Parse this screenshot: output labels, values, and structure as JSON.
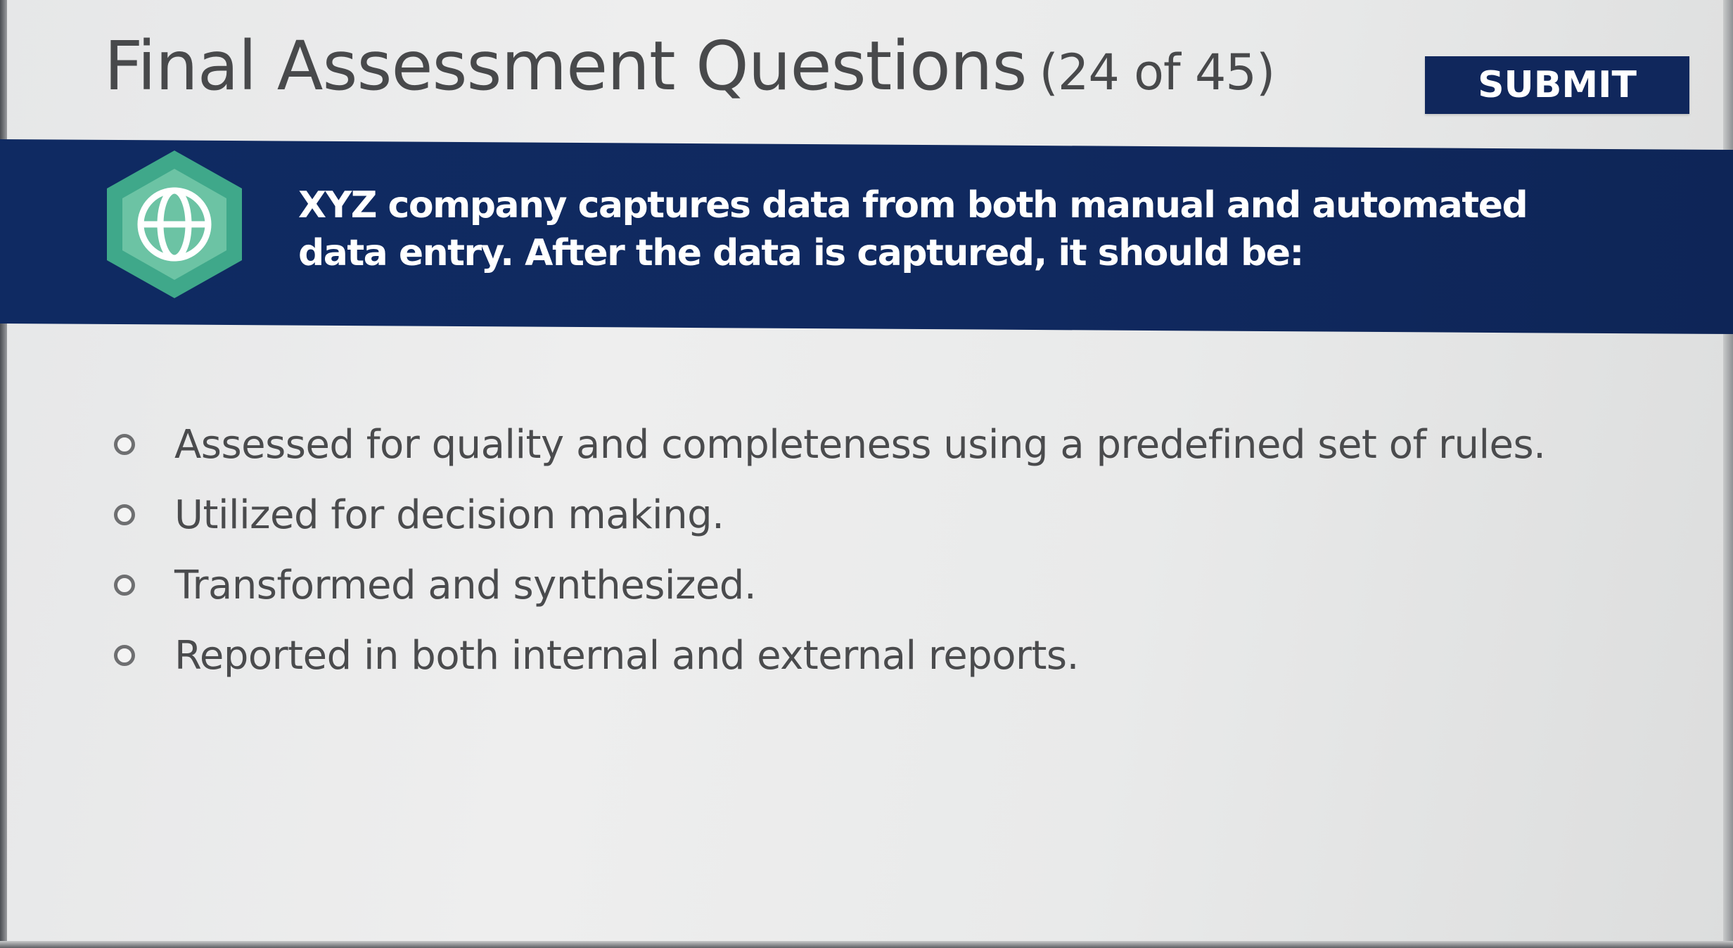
{
  "header": {
    "title": "Final Assessment Questions",
    "counter": "(24 of 45)",
    "submit_label": "SUBMIT"
  },
  "question": {
    "icon": "globe-icon",
    "text": "XYZ company captures data from both manual and automated data entry.  After the data is captured, it should be:"
  },
  "options": [
    {
      "label": "Assessed for quality and completeness using a predefined set of rules.",
      "selected": false
    },
    {
      "label": "Utilized for decision making.",
      "selected": false
    },
    {
      "label": "Transformed and synthesized.",
      "selected": false
    },
    {
      "label": "Reported in both internal and external reports.",
      "selected": false
    }
  ],
  "colors": {
    "banner": "#10295f",
    "submit": "#10275c",
    "badge_outer": "#3fa88a",
    "badge_inner": "#6cc3a4"
  }
}
